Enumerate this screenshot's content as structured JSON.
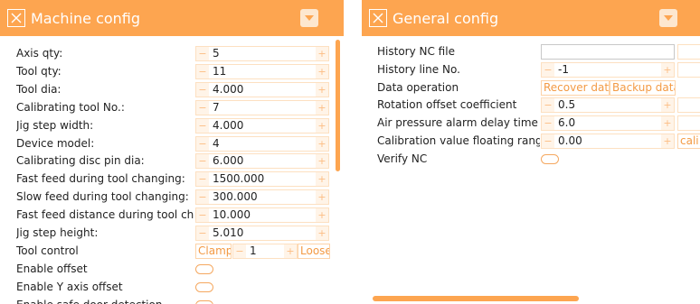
{
  "machine_config": {
    "title": "Machine config",
    "icons": {
      "close": "close-icon",
      "dropdown": "chevron-down-icon"
    },
    "rows": [
      {
        "label": "Axis qty:",
        "type": "stepper",
        "value": "5"
      },
      {
        "label": "Tool qty:",
        "type": "stepper",
        "value": "11"
      },
      {
        "label": "Tool dia:",
        "type": "stepper",
        "value": "4.000"
      },
      {
        "label": "Calibrating tool No.:",
        "type": "stepper",
        "value": "7"
      },
      {
        "label": "Jig step width:",
        "type": "stepper",
        "value": "4.000"
      },
      {
        "label": "Device model:",
        "type": "stepper",
        "value": "4"
      },
      {
        "label": "Calibrating disc pin dia:",
        "type": "stepper",
        "value": "6.000"
      },
      {
        "label": "Fast feed during tool changing:",
        "type": "stepper",
        "value": "1500.000"
      },
      {
        "label": "Slow feed during tool changing:",
        "type": "stepper",
        "value": "300.000"
      },
      {
        "label": "Fast feed distance during tool changing:",
        "type": "stepper",
        "value": "10.000"
      },
      {
        "label": "Jig step height:",
        "type": "stepper",
        "value": "5.010"
      },
      {
        "label": "Tool control",
        "type": "tool-control",
        "clamp": "Clamp",
        "value": "1",
        "loose": "Loose"
      },
      {
        "label": "Enable offset",
        "type": "toggle"
      },
      {
        "label": "Enable Y axis offset",
        "type": "toggle"
      },
      {
        "label": "Enable safe door detection",
        "type": "toggle"
      }
    ]
  },
  "general_config": {
    "title": "General config",
    "rows": [
      {
        "label": "History NC file",
        "type": "text-input",
        "value": ""
      },
      {
        "label": "History line No.",
        "type": "stepper",
        "value": "-1"
      },
      {
        "label": "Data operation",
        "type": "buttons",
        "recover": "Recover data",
        "backup": "Backup data"
      },
      {
        "label": "Rotation offset coefficient",
        "type": "stepper",
        "value": "0.5"
      },
      {
        "label": "Air pressure alarm delay time",
        "type": "stepper",
        "value": "6.0"
      },
      {
        "label": "Calibration value floating range",
        "type": "stepper",
        "value": "0.00",
        "extra": "cali"
      },
      {
        "label": "Verify NC",
        "type": "toggle"
      }
    ]
  },
  "colors": {
    "accent": "#fda550",
    "accent_light": "#fde0c1",
    "accent_text": "#f39a44"
  }
}
